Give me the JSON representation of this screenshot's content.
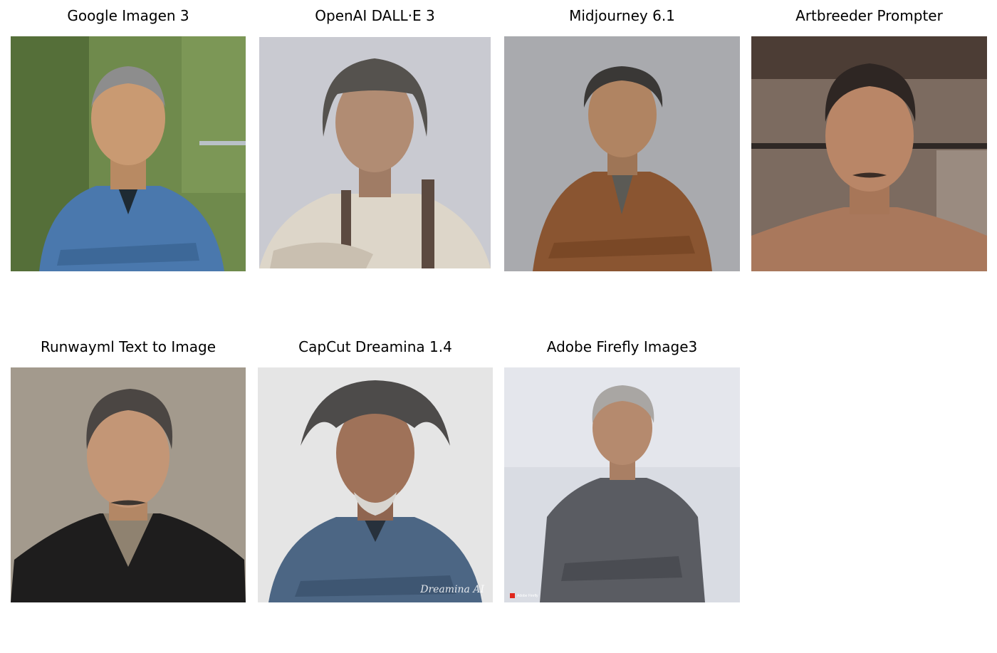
{
  "panels": [
    {
      "title": "Google Imagen 3",
      "palette": {
        "bg": "#6f8a4c",
        "bg2": "#3f5a2a",
        "skin": "#c99a72",
        "hair": "#8d8d8d",
        "shirt": "#4a78ad"
      }
    },
    {
      "title": "OpenAI DALL·E 3",
      "palette": {
        "bg": "#c9cad1",
        "bg2": "#b3b4bd",
        "skin": "#b18c73",
        "hair": "#55524e",
        "shirt": "#ddd6c9"
      }
    },
    {
      "title": "Midjourney 6.1",
      "palette": {
        "bg": "#a9aaae",
        "bg2": "#9b9ca0",
        "skin": "#b08462",
        "hair": "#3a3836",
        "shirt": "#8a5531"
      }
    },
    {
      "title": "Artbreeder Prompter",
      "palette": {
        "bg": "#7c6b60",
        "bg2": "#4c3d35",
        "skin": "#b98667",
        "hair": "#2e2623",
        "shirt": "#a9785c"
      }
    },
    {
      "title": "Runwayml Text to Image",
      "palette": {
        "bg": "#a39a8d",
        "bg2": "#8d8477",
        "skin": "#c39676",
        "hair": "#4b4643",
        "shirt": "#1e1d1d"
      }
    },
    {
      "title": "CapCut Dreamina 1.4",
      "palette": {
        "bg": "#e5e5e5",
        "bg2": "#d4d4d4",
        "skin": "#9f7259",
        "hair": "#4d4b4a",
        "shirt": "#4c6684"
      },
      "watermark": "Dreamina AI"
    },
    {
      "title": "Adobe Firefly Image3",
      "palette": {
        "bg": "#d9dce3",
        "bg2": "#c6cad3",
        "skin": "#b58a6e",
        "hair": "#a9a6a3",
        "shirt": "#5a5c62"
      },
      "watermark": "Adobe Firefly"
    }
  ]
}
